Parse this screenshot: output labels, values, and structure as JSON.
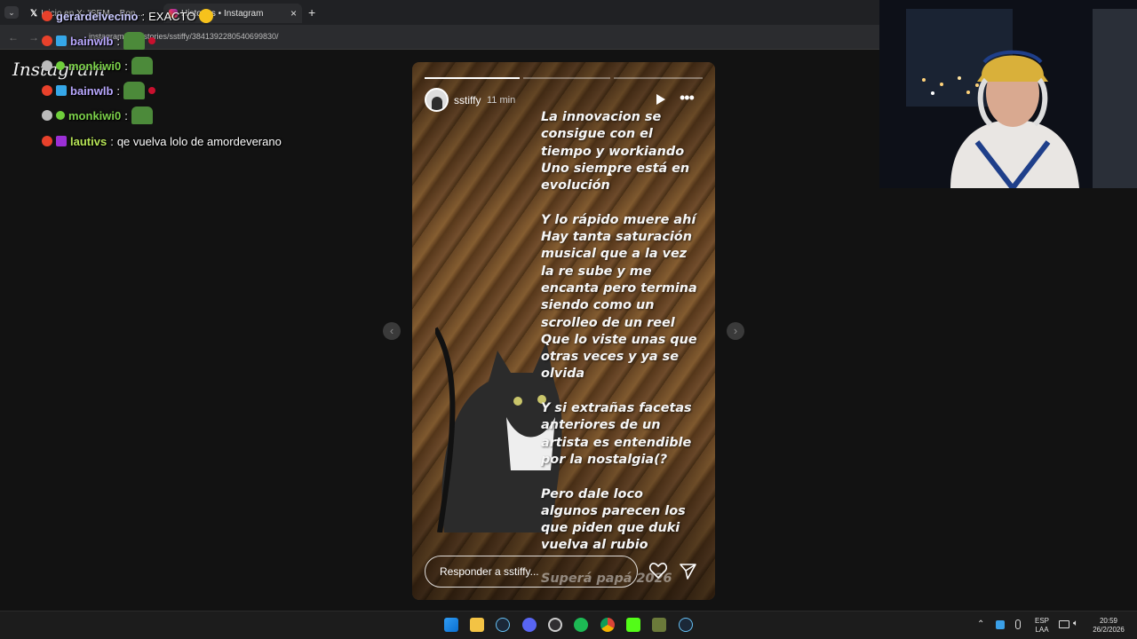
{
  "browser": {
    "tabs": [
      {
        "label": "Inicio en X: \"SEM... Bon..."
      },
      {
        "label": "Historias • Instagram"
      }
    ],
    "new_tab": "+",
    "tab_close": "×",
    "url": "instagram.com/stories/sstiffy/3841392280540699830/"
  },
  "chat": [
    {
      "user": "gerardelvecino",
      "message": "EXACTO",
      "user_color": "#c9c9ff"
    },
    {
      "user": "bainwlb",
      "message": "",
      "user_color": "#b9a8ff"
    },
    {
      "user": "monkiwi0",
      "message": "",
      "user_color": "#7cd14a"
    },
    {
      "user": "bainwlb",
      "message": "",
      "user_color": "#b9a8ff"
    },
    {
      "user": "monkiwi0",
      "message": "",
      "user_color": "#7cd14a"
    },
    {
      "user": "lautivs",
      "message": "qe vuelva lolo de amordeverano",
      "user_color": "#b6e356"
    }
  ],
  "instagram": {
    "logo": "Instagram"
  },
  "story": {
    "username": "sstiffy",
    "time": "11 min",
    "progress": [
      1.0,
      0.0,
      0.0
    ],
    "text": "La innovacion se\nconsigue con el\ntiempo y workiando\nUno siempre está en\nevolución\n\nY lo rápido muere ahí\nHay tanta saturación\nmusical que a la vez\nla re sube y me\nencanta pero termina\nsiendo como un\nscrolleo de un reel\nQue lo viste unas que\notras veces y ya se\nolvida\n\nY si extrañas facetas\nanteriores de un\nartista es entendible\npor la nostalgia(?\n\nPero dale loco\nalgunos parecen los\nque piden que duki\nvuelva al rubio",
    "footer_text": "Superá papá 2026",
    "reply_placeholder": "Responder a sstiffy..."
  },
  "taskbar": {
    "lang_top": "ESP",
    "lang_bottom": "LAA",
    "time": "20:59",
    "date": "26/2/2026"
  },
  "colors": {
    "accent": "#0a84ff",
    "spotify": "#1db954",
    "badge_red": "#e8412b"
  }
}
